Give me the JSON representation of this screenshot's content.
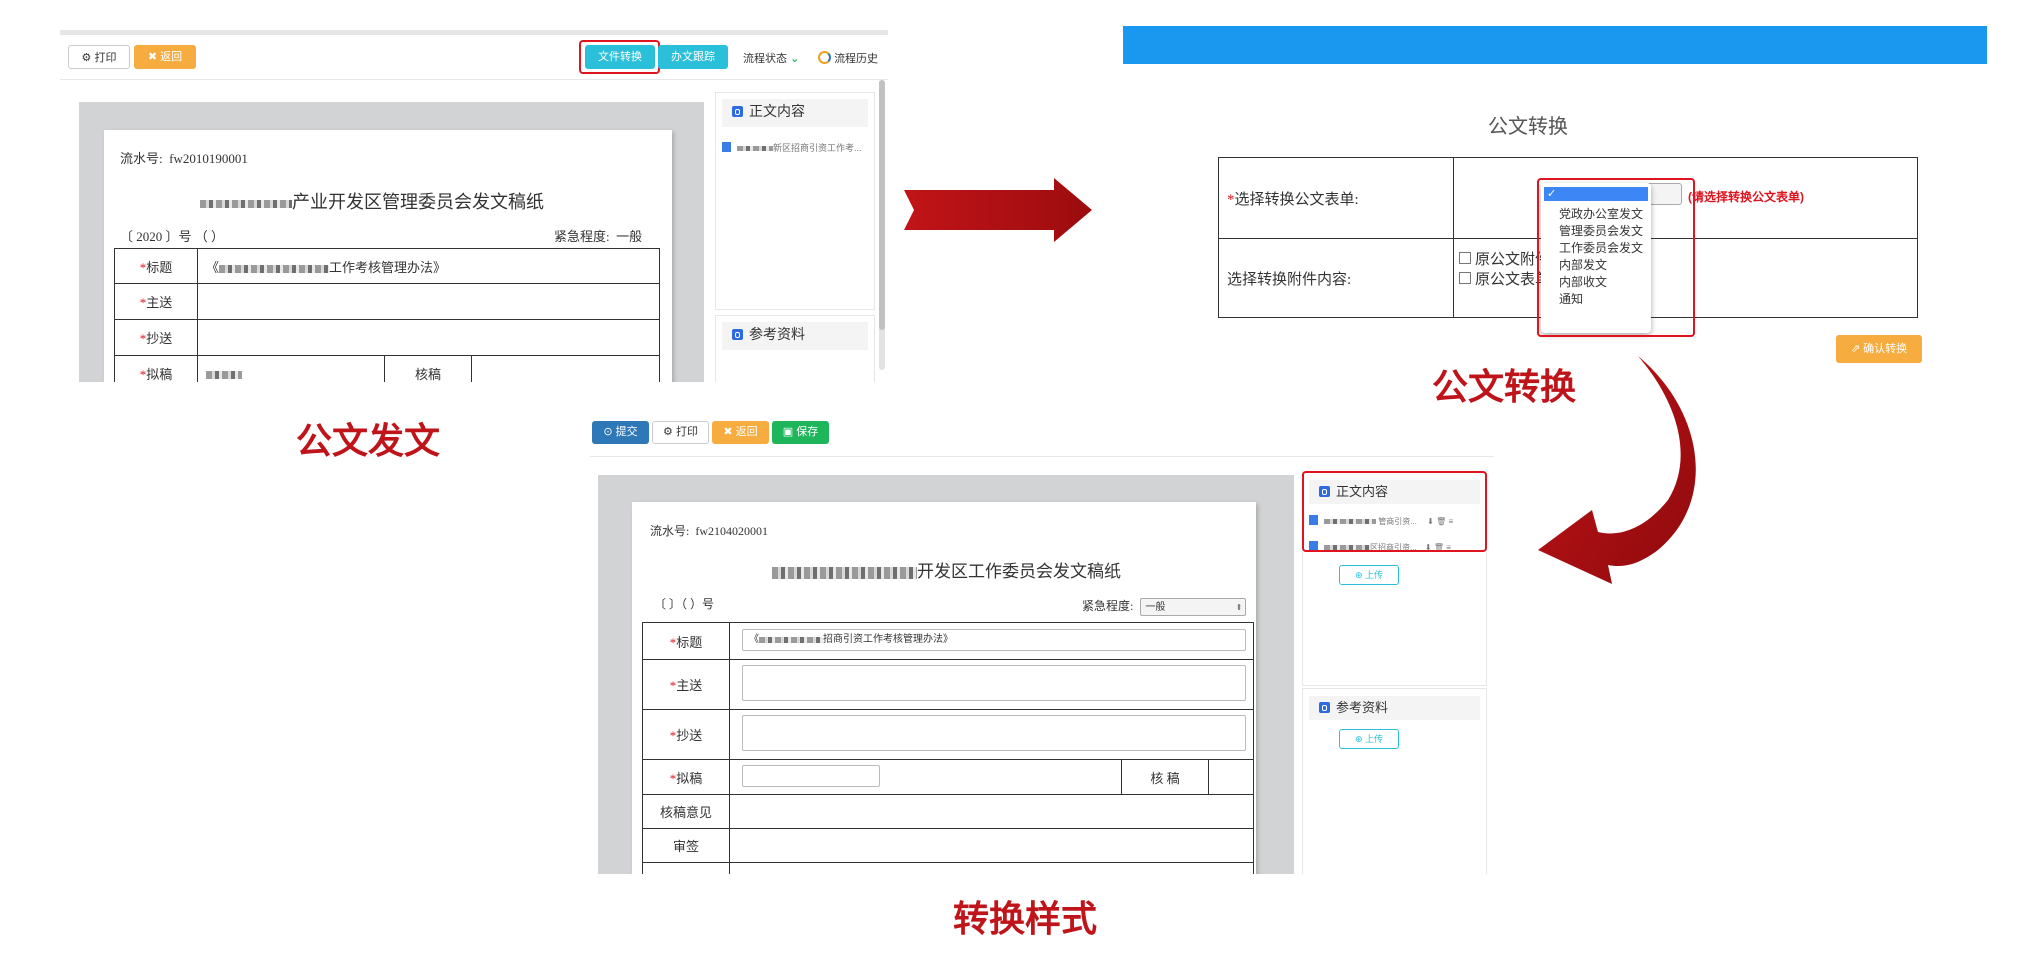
{
  "captions": {
    "send": "公文发文",
    "convert": "公文转换",
    "style": "转换样式"
  },
  "screen1": {
    "toolbar": {
      "print": "打印",
      "back": "返回",
      "file_convert": "文件转换",
      "doc_track": "办文跟踪",
      "flow_status": "流程状态",
      "flow_history": "流程历史"
    },
    "doc": {
      "serial_label": "流水号:",
      "serial_value": "fw2010190001",
      "title_visible": "产业开发区管理委员会发文稿纸",
      "number_line": "〔 2020 〕号 （ ）",
      "urgency_label": "紧急程度:",
      "urgency_value": "一般",
      "rows": [
        {
          "label": "标题",
          "value": "工作考核管理办法》"
        },
        {
          "label": "主送",
          "value": ""
        },
        {
          "label": "抄送",
          "value": ""
        },
        {
          "label": "拟稿",
          "value": "",
          "right_label": "核稿"
        }
      ],
      "title_prefix": "《"
    },
    "side": {
      "body_content": "正文内容",
      "file_name": "新区招商引资工作考...",
      "reference": "参考资料"
    }
  },
  "screen2": {
    "title": "公文转换",
    "row1_label": "选择转换公文表单:",
    "row1_hint": "(请选择转换公文表单)",
    "row2_label": "选择转换附件内容:",
    "checkbox1": "原公文附件",
    "checkbox2": "原公文表单",
    "options": [
      "党政办公室发文",
      "管理委员会发文",
      "工作委员会发文",
      "内部发文",
      "内部收文",
      "通知"
    ],
    "confirm": "确认转换",
    "accent_color": "#1a98f0"
  },
  "screen3": {
    "toolbar": {
      "submit": "提交",
      "print": "打印",
      "back": "返回",
      "save": "保存"
    },
    "doc": {
      "serial_label": "流水号:",
      "serial_value": "fw2104020001",
      "title_visible": "开发区工作委员会发文稿纸",
      "number_line": "〔 〕（ ）号",
      "urgency_label": "紧急程度:",
      "urgency_value": "一般",
      "title_field_value": "招商引资工作考核管理办法》",
      "rows": [
        {
          "label": "标题"
        },
        {
          "label": "主送"
        },
        {
          "label": "抄送"
        },
        {
          "label": "拟稿",
          "right_label": "核 稿"
        },
        {
          "label": "核稿意见"
        },
        {
          "label": "审签"
        }
      ]
    },
    "side": {
      "body_content": "正文内容",
      "file1": "管商引资...",
      "file2": "区招商引资...",
      "upload": "上传",
      "reference": "参考资料",
      "upload2": "上传"
    }
  }
}
